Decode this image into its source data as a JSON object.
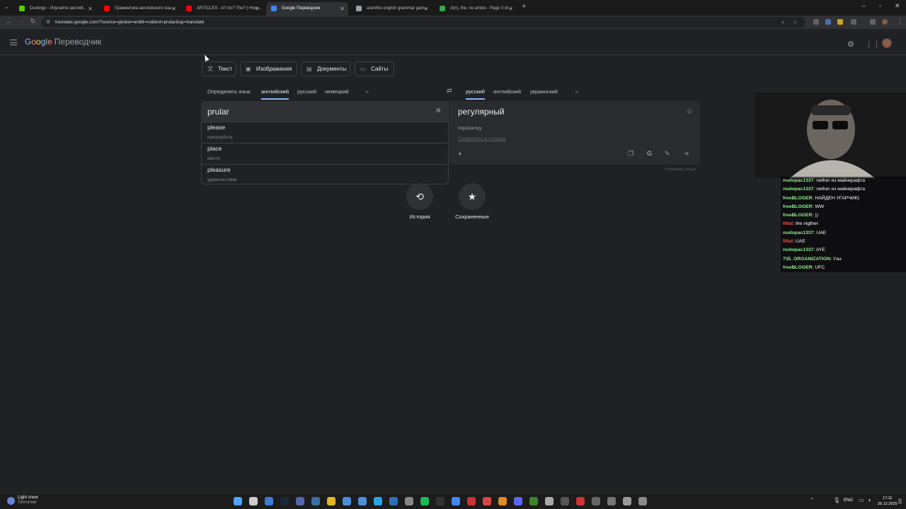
{
  "browser": {
    "tabs": [
      {
        "title": "Duolingo - Изучайте англий...",
        "favicon_color": "#58cc02",
        "active": false
      },
      {
        "title": "Грамматика английского язы...",
        "favicon_color": "#ff0000",
        "active": false
      },
      {
        "title": "ARTICLES - A? An? The? | How ...",
        "favicon_color": "#ff0000",
        "active": false
      },
      {
        "title": "Google Переводчик",
        "favicon_color": "#4285f4",
        "active": true
      },
      {
        "title": "a/an/the english grammar gam...",
        "favicon_color": "#9aa0a6",
        "active": false
      },
      {
        "title": "A(n), the, no article - Page 3 of...",
        "favicon_color": "#34a853",
        "active": false
      }
    ],
    "url": "translate.google.com/?source=gtx&sl=en&tl=ru&text=prular&op=translate"
  },
  "header": {
    "logo_letters": [
      "G",
      "o",
      "o",
      "g",
      "l",
      "e"
    ],
    "app_name": "Переводчик"
  },
  "modes": [
    {
      "label": "Текст",
      "icon": "translate-icon"
    },
    {
      "label": "Изображения",
      "icon": "image-icon"
    },
    {
      "label": "Документы",
      "icon": "document-icon"
    },
    {
      "label": "Сайты",
      "icon": "website-icon"
    }
  ],
  "source_langs": [
    "Определить язык",
    "английский",
    "русский",
    "немецкий"
  ],
  "target_langs": [
    "русский",
    "английский",
    "украинский"
  ],
  "source": {
    "text": "prular"
  },
  "suggestions": [
    {
      "word": "please",
      "translation": "пожалуйста"
    },
    {
      "word": "place",
      "translation": "место"
    },
    {
      "word": "pleasure",
      "translation": "удовольствие"
    }
  ],
  "target": {
    "text": "регулярный",
    "translit": "regulyarnyy",
    "dict_link": "Посмотреть в словаре"
  },
  "feedback": "Отправить отзыв",
  "shortcuts": [
    {
      "label": "История",
      "icon": "history-icon"
    },
    {
      "label": "Сохраненные",
      "icon": "star-icon"
    }
  ],
  "chat": [
    {
      "user": "nudopac1337",
      "color": "#8ef08e",
      "msg": "nether из майнкрафта"
    },
    {
      "user": "nudopac1337",
      "color": "#8ef08e",
      "msg": "nether из майнкрафта"
    },
    {
      "user": "freeBLOGER",
      "color": "#8ef08e",
      "msg": "НАЙДЕН УГАРЧИК)"
    },
    {
      "user": "freeBLOGER",
      "color": "#8ef08e",
      "msg": "WW"
    },
    {
      "user": "freeBLOGER",
      "color": "#8ef08e",
      "msg": "))"
    },
    {
      "user": "fifial",
      "color": "#ff4d4d",
      "msg": "the nigther"
    },
    {
      "user": "nudopac1337",
      "color": "#8ef08e",
      "msg": "UAE"
    },
    {
      "user": "fifial",
      "color": "#ff4d4d",
      "msg": "UAE"
    },
    {
      "user": "nudopac1337",
      "color": "#8ef08e",
      "msg": "AYE"
    },
    {
      "user": "735_ORGANIZATION",
      "color": "#8ef08e",
      "msg": "Уаэ"
    },
    {
      "user": "freeBLOGER",
      "color": "#8ef08e",
      "msg": "UFC"
    }
  ],
  "taskbar": {
    "weather_main": "Light snow",
    "weather_sub": "Tomorrow",
    "lang": "ENG",
    "time": "17:11",
    "date": "26.12.2025"
  }
}
